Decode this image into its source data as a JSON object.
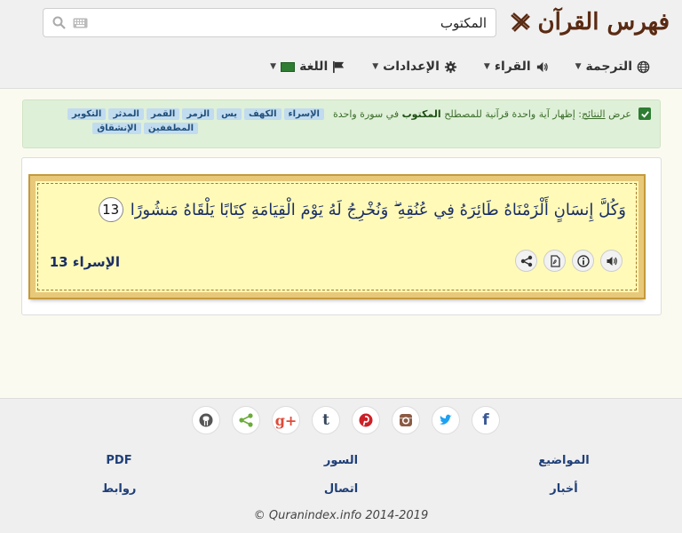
{
  "header": {
    "logo_text": "فهرس القرآن",
    "search": {
      "value": "المكتوب",
      "placeholder": ""
    }
  },
  "nav": {
    "items": [
      {
        "label": "الترجمة",
        "icon": "globe-icon"
      },
      {
        "label": "القراء",
        "icon": "speaker-icon"
      },
      {
        "label": "الإعدادات",
        "icon": "gear-icon"
      },
      {
        "label": "اللغة",
        "icon": "flag-icon"
      }
    ]
  },
  "alert": {
    "prefix": "عرض",
    "link": "النتائج",
    "text_before": ": إظهار آية واحدة قرآنية للمصطلح",
    "term": "المكتوب",
    "text_after": "في سورة واحدة",
    "tags": [
      "الإسراء",
      "الكهف",
      "يس",
      "الزمر",
      "القمر",
      "المدثر",
      "التكوير",
      "المطففين",
      "الإنشقاق"
    ]
  },
  "verse": {
    "text": "وَكُلَّ إِنسَانٍ أَلْزَمْنَاهُ طَائِرَهُ فِي عُنُقِهِ ۖ وَنُخْرِجُ لَهُ يَوْمَ الْقِيَامَةِ كِتَابًا يَلْقَاهُ مَنشُورًا",
    "number": "13",
    "reference": "الإسراء 13"
  },
  "footer": {
    "social": [
      "github-icon",
      "share-icon",
      "googleplus-icon",
      "tumblr-icon",
      "pinterest-icon",
      "instagram-icon",
      "twitter-icon",
      "facebook-icon"
    ],
    "col_right": [
      "المواضيع",
      "أخبار"
    ],
    "col_mid": [
      "السور",
      "اتصال"
    ],
    "col_left": [
      "PDF",
      "روابط"
    ],
    "copyright": "© Quranindex.info 2014-2019"
  },
  "colors": {
    "logo": "#5a2a12",
    "verse": "#1a2e66",
    "alert_bg": "#dff0d8",
    "card_bg": "#fffab8"
  }
}
